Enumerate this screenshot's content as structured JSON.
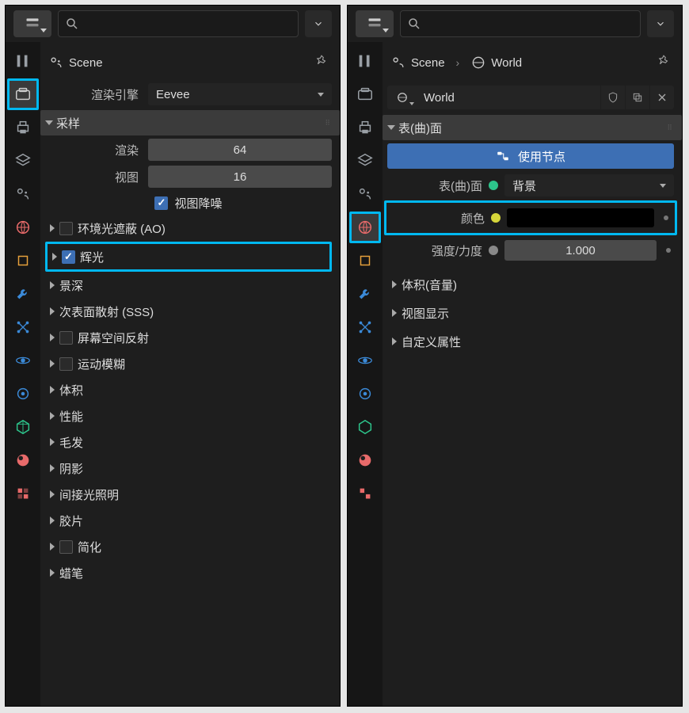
{
  "left": {
    "breadcrumb": {
      "scene": "Scene"
    },
    "render_engine_label": "渲染引擎",
    "render_engine_value": "Eevee",
    "sampling": {
      "header": "采样",
      "render_label": "渲染",
      "render_value": "64",
      "viewport_label": "视图",
      "viewport_value": "16",
      "viewport_denoise": "视图降噪"
    },
    "sections": [
      {
        "label": "环境光遮蔽 (AO)",
        "checkbox": true,
        "checked": false
      },
      {
        "label": "辉光",
        "checkbox": true,
        "checked": true,
        "highlight": true
      },
      {
        "label": "景深",
        "checkbox": false
      },
      {
        "label": "次表面散射 (SSS)",
        "checkbox": false
      },
      {
        "label": "屏幕空间反射",
        "checkbox": true,
        "checked": false
      },
      {
        "label": "运动模糊",
        "checkbox": true,
        "checked": false
      },
      {
        "label": "体积",
        "checkbox": false
      },
      {
        "label": "性能",
        "checkbox": false
      },
      {
        "label": "毛发",
        "checkbox": false
      },
      {
        "label": "阴影",
        "checkbox": false
      },
      {
        "label": "间接光照明",
        "checkbox": false
      },
      {
        "label": "胶片",
        "checkbox": false
      },
      {
        "label": "简化",
        "checkbox": true,
        "checked": false
      },
      {
        "label": "蜡笔",
        "checkbox": false
      }
    ]
  },
  "right": {
    "breadcrumb": {
      "scene": "Scene",
      "world": "World"
    },
    "world_name": "World",
    "surface_header": "表(曲)面",
    "use_nodes": "使用节点",
    "surface_label": "表(曲)面",
    "surface_value": "背景",
    "color_label": "颜色",
    "strength_label": "强度/力度",
    "strength_value": "1.000",
    "sections": [
      {
        "label": "体积(音量)"
      },
      {
        "label": "视图显示"
      },
      {
        "label": "自定义属性"
      }
    ]
  },
  "icon_colors": {
    "tool": "#9aa0a6",
    "render": "#9aa0a6",
    "output": "#9aa0a6",
    "viewlayer": "#9aa0a6",
    "scene": "#9aa0a6",
    "world": "#e86a6a",
    "object": "#e8a23c",
    "wrench": "#3b8ad8",
    "particle": "#3b8ad8",
    "physics": "#3b8ad8",
    "constraint": "#3b8ad8",
    "mesh": "#2dc48b",
    "material": "#e86a6a",
    "texture": "#e86a6a"
  }
}
